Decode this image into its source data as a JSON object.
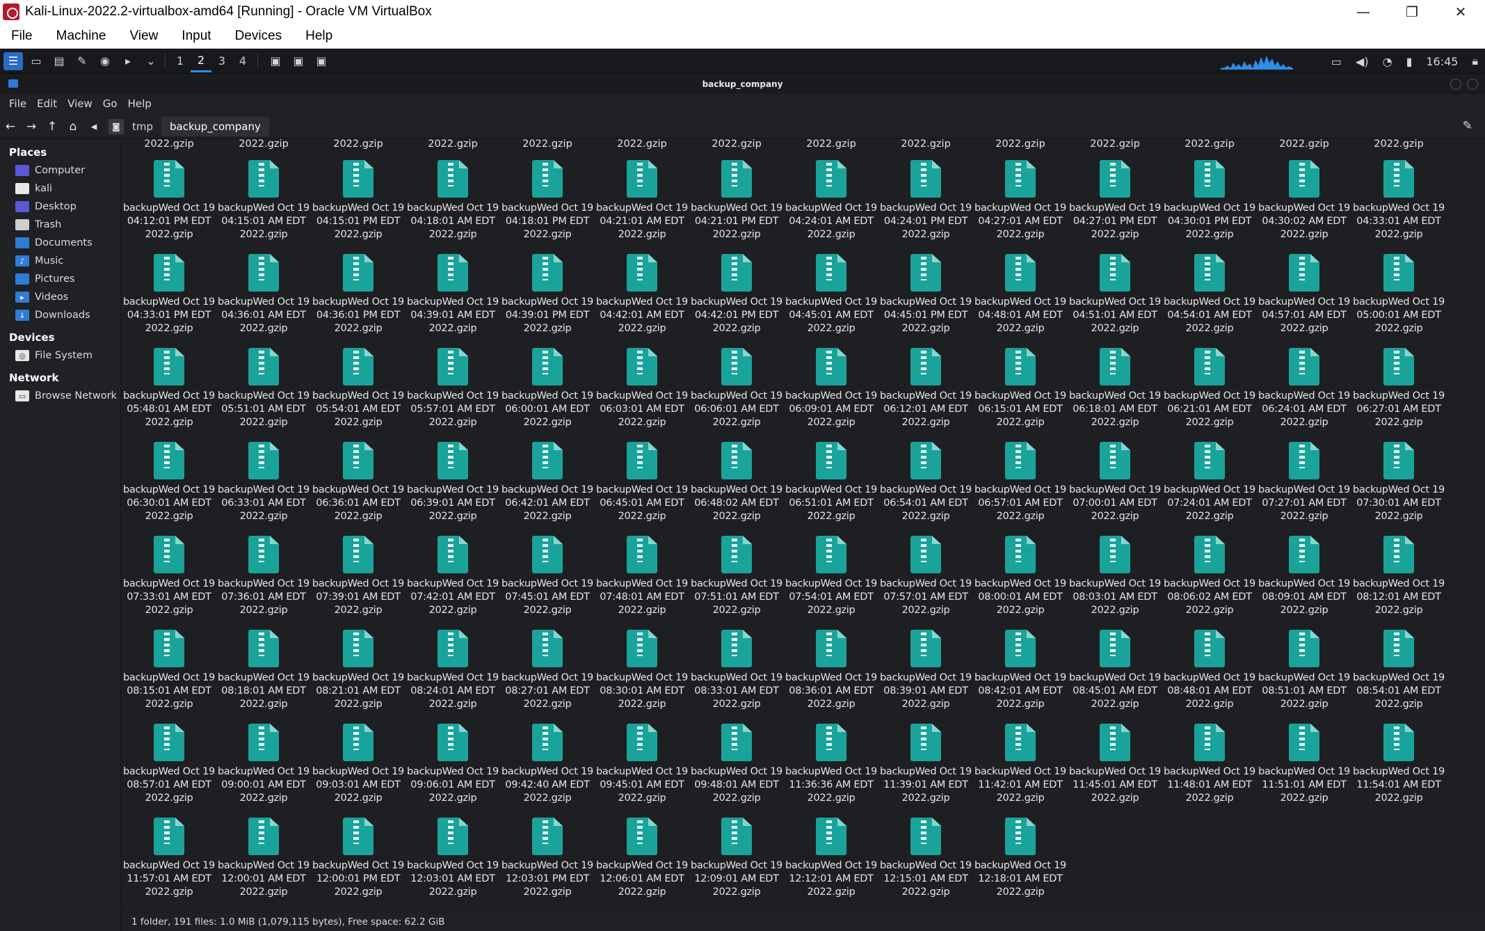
{
  "host": {
    "title": "Kali-Linux-2022.2-virtualbox-amd64 [Running] - Oracle VM VirtualBox",
    "menu": [
      "File",
      "Machine",
      "View",
      "Input",
      "Devices",
      "Help"
    ],
    "controls": [
      "—",
      "❐",
      "✕"
    ]
  },
  "panel": {
    "workspaces": [
      "1",
      "2",
      "3",
      "4"
    ],
    "active_workspace": "2",
    "clock": "16:45",
    "graph_color": "#2f8de4"
  },
  "window": {
    "title": "backup_company",
    "menu": [
      "File",
      "Edit",
      "View",
      "Go",
      "Help"
    ],
    "breadcrumbs": [
      "tmp",
      "backup_company"
    ]
  },
  "sidebar": {
    "places_header": "Places",
    "places": [
      {
        "label": "Computer",
        "icon": "monitor-icon"
      },
      {
        "label": "kali",
        "icon": "home-folder-icon"
      },
      {
        "label": "Desktop",
        "icon": "desktop-icon"
      },
      {
        "label": "Trash",
        "icon": "trash-icon"
      },
      {
        "label": "Documents",
        "icon": "documents-folder-icon"
      },
      {
        "label": "Music",
        "icon": "music-folder-icon"
      },
      {
        "label": "Pictures",
        "icon": "pictures-folder-icon"
      },
      {
        "label": "Videos",
        "icon": "videos-folder-icon"
      },
      {
        "label": "Downloads",
        "icon": "downloads-folder-icon"
      }
    ],
    "devices_header": "Devices",
    "devices": [
      {
        "label": "File System",
        "icon": "disk-icon"
      }
    ],
    "network_header": "Network",
    "network": [
      {
        "label": "Browse Network",
        "icon": "network-icon"
      }
    ]
  },
  "files": {
    "prefix": "backupWed Oct 19",
    "suffix": "2022.gzip",
    "partial_row_suffix": "2022.gzip",
    "times": [
      "04:12:01 PM EDT",
      "04:15:01 AM EDT",
      "04:15:01 PM EDT",
      "04:18:01 AM EDT",
      "04:18:01 PM EDT",
      "04:21:01 AM EDT",
      "04:21:01 PM EDT",
      "04:24:01 AM EDT",
      "04:24:01 PM EDT",
      "04:27:01 AM EDT",
      "04:27:01 PM EDT",
      "04:30:01 PM EDT",
      "04:30:02 AM EDT",
      "04:33:01 AM EDT",
      "04:33:01 PM EDT",
      "04:36:01 AM EDT",
      "04:36:01 PM EDT",
      "04:39:01 AM EDT",
      "04:39:01 PM EDT",
      "04:42:01 AM EDT",
      "04:42:01 PM EDT",
      "04:45:01 AM EDT",
      "04:45:01 PM EDT",
      "04:48:01 AM EDT",
      "04:51:01 AM EDT",
      "04:54:01 AM EDT",
      "04:57:01 AM EDT",
      "05:00:01 AM EDT",
      "05:48:01 AM EDT",
      "05:51:01 AM EDT",
      "05:54:01 AM EDT",
      "05:57:01 AM EDT",
      "06:00:01 AM EDT",
      "06:03:01 AM EDT",
      "06:06:01 AM EDT",
      "06:09:01 AM EDT",
      "06:12:01 AM EDT",
      "06:15:01 AM EDT",
      "06:18:01 AM EDT",
      "06:21:01 AM EDT",
      "06:24:01 AM EDT",
      "06:27:01 AM EDT",
      "06:30:01 AM EDT",
      "06:33:01 AM EDT",
      "06:36:01 AM EDT",
      "06:39:01 AM EDT",
      "06:42:01 AM EDT",
      "06:45:01 AM EDT",
      "06:48:02 AM EDT",
      "06:51:01 AM EDT",
      "06:54:01 AM EDT",
      "06:57:01 AM EDT",
      "07:00:01 AM EDT",
      "07:24:01 AM EDT",
      "07:27:01 AM EDT",
      "07:30:01 AM EDT",
      "07:33:01 AM EDT",
      "07:36:01 AM EDT",
      "07:39:01 AM EDT",
      "07:42:01 AM EDT",
      "07:45:01 AM EDT",
      "07:48:01 AM EDT",
      "07:51:01 AM EDT",
      "07:54:01 AM EDT",
      "07:57:01 AM EDT",
      "08:00:01 AM EDT",
      "08:03:01 AM EDT",
      "08:06:02 AM EDT",
      "08:09:01 AM EDT",
      "08:12:01 AM EDT",
      "08:15:01 AM EDT",
      "08:18:01 AM EDT",
      "08:21:01 AM EDT",
      "08:24:01 AM EDT",
      "08:27:01 AM EDT",
      "08:30:01 AM EDT",
      "08:33:01 AM EDT",
      "08:36:01 AM EDT",
      "08:39:01 AM EDT",
      "08:42:01 AM EDT",
      "08:45:01 AM EDT",
      "08:48:01 AM EDT",
      "08:51:01 AM EDT",
      "08:54:01 AM EDT",
      "08:57:01 AM EDT",
      "09:00:01 AM EDT",
      "09:03:01 AM EDT",
      "09:06:01 AM EDT",
      "09:42:40 AM EDT",
      "09:45:01 AM EDT",
      "09:48:01 AM EDT",
      "11:36:36 AM EDT",
      "11:39:01 AM EDT",
      "11:42:01 AM EDT",
      "11:45:01 AM EDT",
      "11:48:01 AM EDT",
      "11:51:01 AM EDT",
      "11:54:01 AM EDT",
      "11:57:01 AM EDT",
      "12:00:01 AM EDT",
      "12:00:01 PM EDT",
      "12:03:01 AM EDT",
      "12:03:01 PM EDT",
      "12:06:01 AM EDT",
      "12:09:01 AM EDT",
      "12:12:01 AM EDT",
      "12:15:01 AM EDT",
      "12:18:01 AM EDT"
    ]
  },
  "status": "1 folder, 191 files: 1.0 MiB (1,079,115 bytes), Free space: 62.2 GiB"
}
